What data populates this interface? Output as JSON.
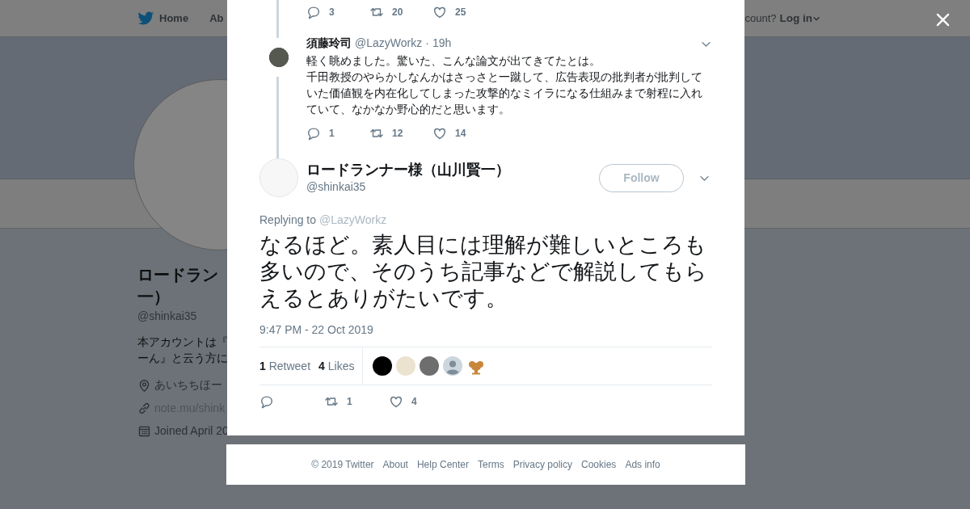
{
  "background_page": {
    "nav": {
      "items": [
        {
          "label": "Home",
          "kind": "home"
        },
        {
          "label": "Ab",
          "kind": "plain"
        }
      ],
      "login_prompt": "count?",
      "login": "Log in"
    },
    "profile": {
      "name_lines": [
        "ロードラン",
        "一）"
      ],
      "handle": "@shinkai35",
      "bio_lines": [
        "本アカウントは『",
        "ーん』と云う方に"
      ],
      "location": "あいちちほー",
      "url": "note.mu/shink",
      "joined": "Joined April 20"
    }
  },
  "conversation": {
    "previous_actions": {
      "replies": "3",
      "retweets": "20",
      "likes": "25"
    },
    "reply": {
      "name": "須藤玲司",
      "handle": "@LazyWorkz",
      "separator": "·",
      "time": "19h",
      "lines": [
        "軽く眺めました。驚いた、こんな論文が出てきてたとは。",
        "千田教授のやらかしなんかはさっさと一蹴して、広告表現の批判者が批判していた価値観を内在化してしまった攻撃的なミイラになる仕組みまで射程に入れていて、なかなか野心的だと思います。"
      ],
      "actions": {
        "replies": "1",
        "retweets": "12",
        "likes": "14"
      }
    }
  },
  "tweet": {
    "name": "ロードランナー様（山川賢一）",
    "handle": "@shinkai35",
    "follow": "Follow",
    "replying_label": "Replying to",
    "replying_to": "@LazyWorkz",
    "text": "なるほど。素人目には理解が難しいところも多いので、そのうち記事などで解説してもらえるとありがたいです。",
    "date": "9:47 PM - 22 Oct 2019",
    "retweet_count": "1",
    "retweet_label": "Retweet",
    "like_count": "4",
    "like_label": "Likes",
    "likers": [
      {
        "kind": "photo",
        "color": "#000000"
      },
      {
        "kind": "photo",
        "color": "#ece2d0"
      },
      {
        "kind": "photo",
        "color": "#6e6e6e"
      },
      {
        "kind": "default",
        "color": "#ccd6dd"
      },
      {
        "kind": "figure",
        "color": "#c8873a"
      }
    ],
    "actions": {
      "retweets": "1",
      "likes": "4"
    }
  },
  "footer": [
    "© 2019 Twitter",
    "About",
    "Help Center",
    "Terms",
    "Privacy policy",
    "Cookies",
    "Ads info"
  ]
}
